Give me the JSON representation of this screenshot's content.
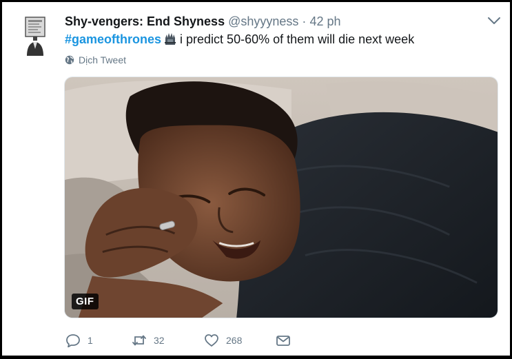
{
  "tweet": {
    "display_name": "Shy-vengers: End Shyness",
    "handle": "@shyyyness",
    "separator": "·",
    "time": "42 ph",
    "hashtag": "#gameofthrones",
    "text": "i predict 50-60% of them will die next week",
    "translate_label": "Dịch Tweet",
    "media_badge": "GIF"
  },
  "actions": {
    "reply_count": "1",
    "retweet_count": "32",
    "like_count": "268"
  },
  "colors": {
    "link": "#1b95e0",
    "muted": "#657786",
    "text": "#14171a"
  }
}
